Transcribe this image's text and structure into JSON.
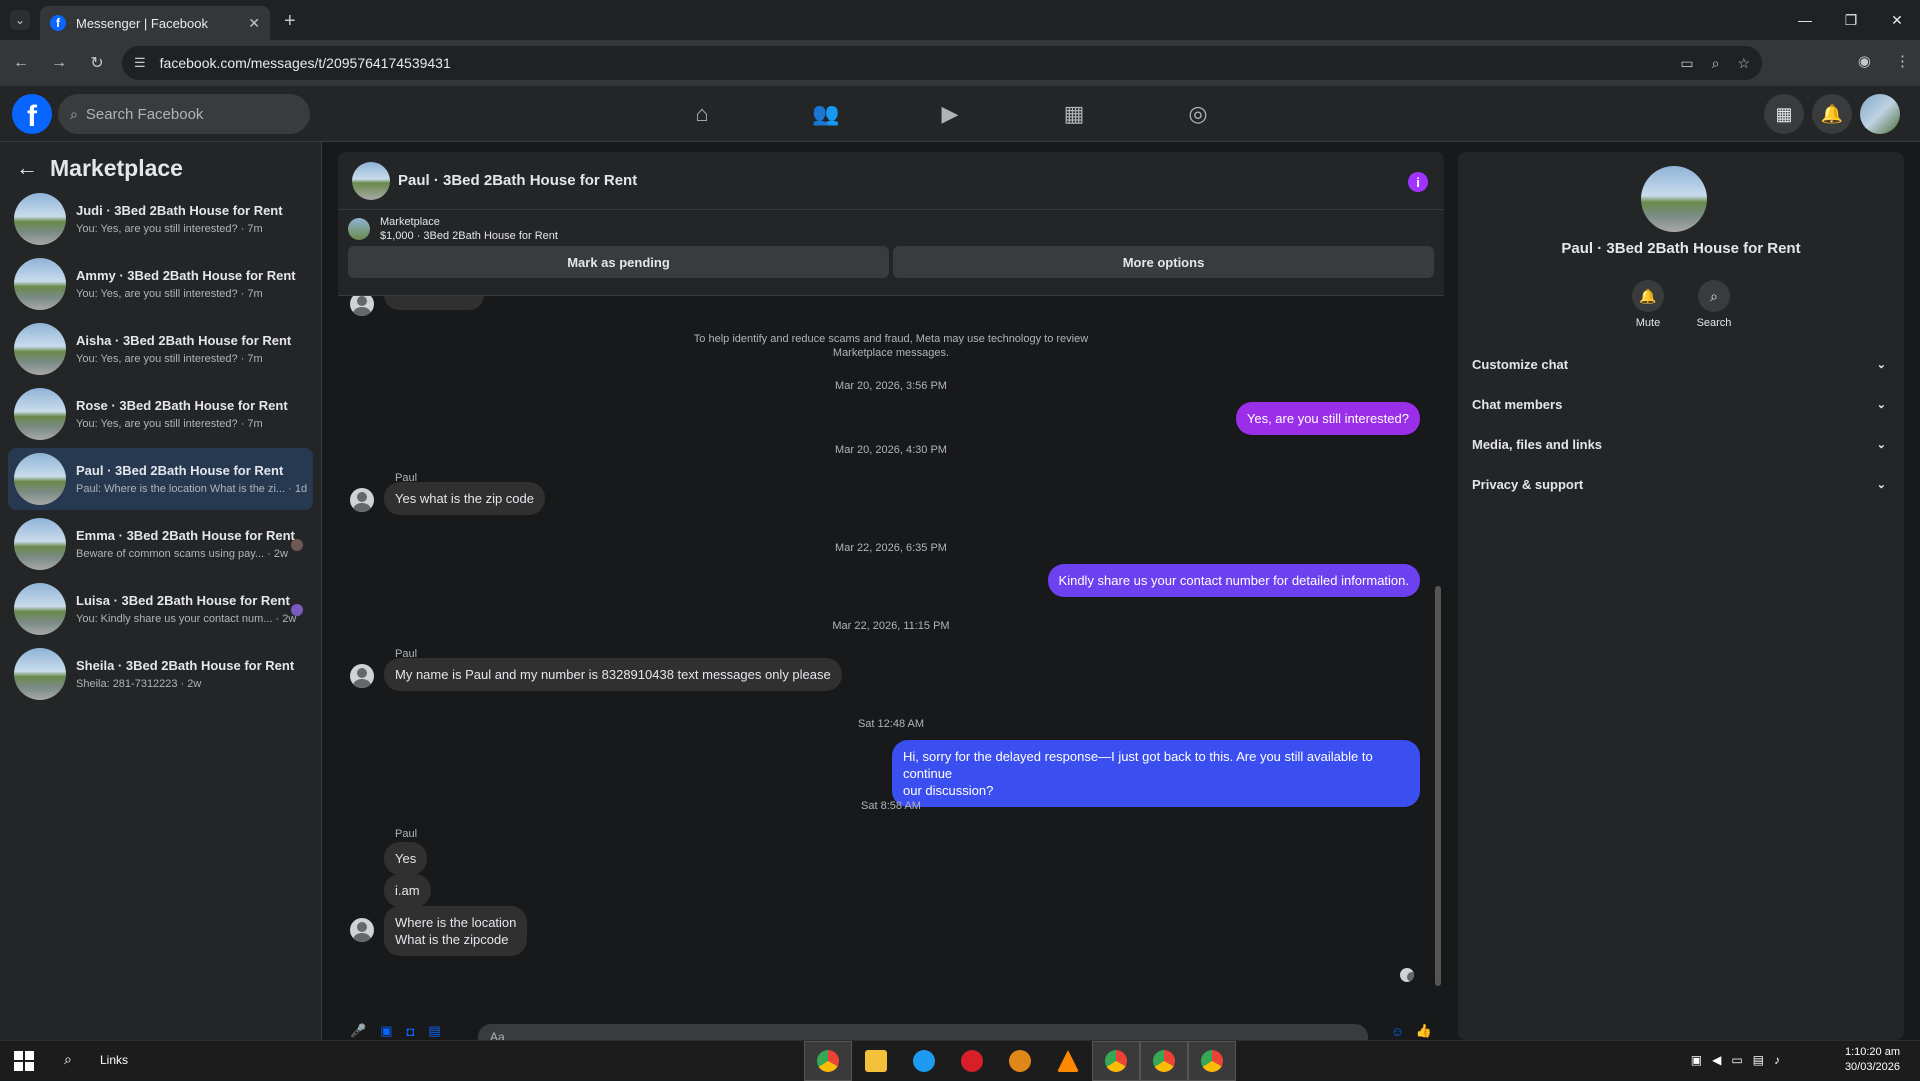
{
  "browser": {
    "tab_title": "Messenger | Facebook",
    "url": "facebook.com/messages/t/2095764174539431"
  },
  "fb": {
    "search_placeholder": "Search Facebook"
  },
  "left_panel": {
    "title": "Marketplace",
    "conversations": [
      {
        "name": "Judi · 3Bed 2Bath House for Rent",
        "last": "You: Yes, are you still interested? · 7m"
      },
      {
        "name": "Ammy · 3Bed 2Bath House for Rent",
        "last": "You: Yes, are you still interested? · 7m"
      },
      {
        "name": "Aisha · 3Bed 2Bath House for Rent",
        "last": "You: Yes, are you still interested? · 7m"
      },
      {
        "name": "Rose · 3Bed 2Bath House for Rent",
        "last": "You: Yes, are you still interested? · 7m"
      },
      {
        "name": "Paul · 3Bed 2Bath House for Rent",
        "last": "Paul: Where is the location What is the zi... · 1d"
      },
      {
        "name": "Emma · 3Bed 2Bath House for Rent",
        "last": "Beware of common scams using pay... · 2w"
      },
      {
        "name": "Luisa · 3Bed 2Bath House for Rent",
        "last": "You: Kindly share us your contact num... · 2w"
      },
      {
        "name": "Sheila · 3Bed 2Bath House for Rent",
        "last": "Sheila: 281-7312223 · 2w"
      }
    ]
  },
  "chat": {
    "title": "Paul · 3Bed 2Bath House for Rent",
    "marketplace_label": "Marketplace",
    "listing": "$1,000 · 3Bed 2Bath House for Rent",
    "btn_pending": "Mark as pending",
    "btn_more": "More options",
    "system_note_1": "To help identify and reduce scams and fraud, Meta may use technology to review",
    "system_note_2": "Marketplace messages.",
    "ts1": "Mar 20, 2026, 3:56 PM",
    "out1": "Yes, are you still interested?",
    "ts2": "Mar 20, 2026, 4:30 PM",
    "sender": "Paul",
    "in1": "Yes what is the zip code",
    "ts3": "Mar 22, 2026, 6:35 PM",
    "out2": "Kindly share us your contact number for detailed information.",
    "ts4": "Mar 22, 2026, 11:15 PM",
    "in2": "My name is Paul and my number is 8328910438 text messages only please",
    "ts5": "Sat 12:48 AM",
    "out3_line1": "Hi, sorry for the delayed response—I just got back to this. Are you still available to continue",
    "out3_line2": "our discussion?",
    "ts6": "Sat 8:58 AM",
    "in3": "Yes",
    "in4": "i.am",
    "in5_line1": "Where is the location",
    "in5_line2": "What is the zipcode",
    "composer_placeholder": "Aa"
  },
  "right_panel": {
    "name": "Paul · 3Bed 2Bath House for Rent",
    "mute": "Mute",
    "search": "Search",
    "sections": [
      "Customize chat",
      "Chat members",
      "Media, files and links",
      "Privacy & support"
    ]
  },
  "taskbar": {
    "search_label": "Links",
    "time": "1:10:20 am",
    "date": "30/03/2026"
  },
  "colors": {
    "out_bubble_purple": "#9b2ee8",
    "out_bubble_blue": "#3b4ef0",
    "accent": "#0866ff"
  }
}
